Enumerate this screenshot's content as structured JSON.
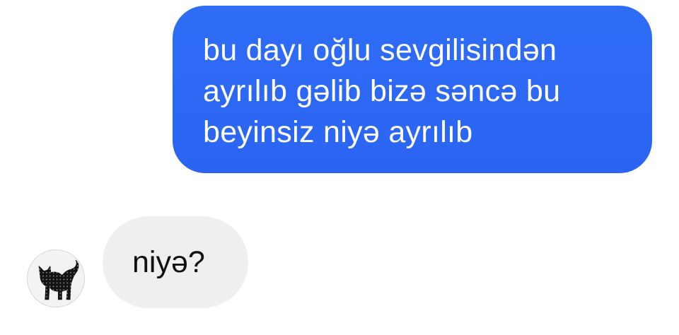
{
  "conversation": {
    "outgoing": {
      "lines": [
        "bu dayı oğlu sevgilisindən",
        "ayrılıb gəlib bizə səncə bu",
        "beyinsiz niyə ayrılıb"
      ],
      "bubble_color": "#2f6df6",
      "text_color": "#ffffff"
    },
    "incoming": {
      "text": "niyə?",
      "bubble_color": "#efefef",
      "text_color": "#111111",
      "avatar": {
        "icon": "black-cat-icon"
      }
    }
  }
}
